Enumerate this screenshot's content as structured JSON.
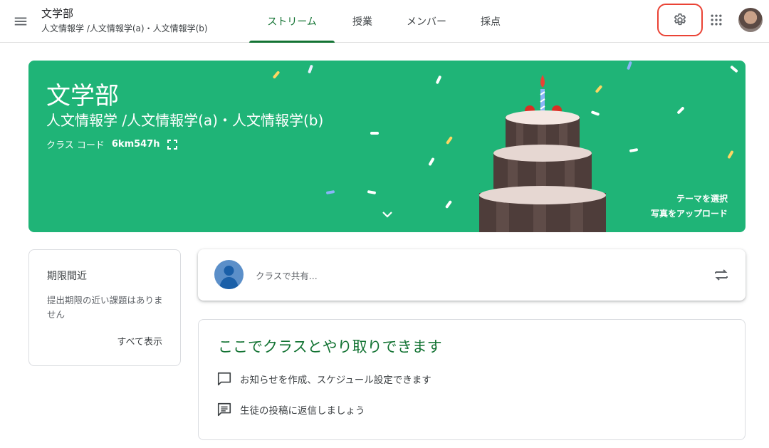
{
  "header": {
    "course_title": "文学部",
    "course_section": "人文情報学 /人文情報学(a)・人文情報学(b)",
    "tabs": [
      {
        "label": "ストリーム",
        "active": true
      },
      {
        "label": "授業",
        "active": false
      },
      {
        "label": "メンバー",
        "active": false
      },
      {
        "label": "採点",
        "active": false
      }
    ],
    "icons": [
      "menu-icon",
      "gear-icon",
      "apps-grid-icon",
      "user-avatar"
    ]
  },
  "banner": {
    "title": "文学部",
    "subtitle": "人文情報学 /人文情報学(a)・人文情報学(b)",
    "class_code_label": "クラス コード",
    "class_code_value": "6km547h",
    "select_theme": "テーマを選択",
    "upload_photo": "写真をアップロード",
    "background_color": "#1fb477"
  },
  "upcoming": {
    "title": "期限間近",
    "text": "提出期限の近い課題はありません",
    "view_all": "すべて表示"
  },
  "share": {
    "placeholder": "クラスで共有..."
  },
  "info": {
    "title": "ここでクラスとやり取りできます",
    "items": [
      "お知らせを作成、スケジュール設定できます",
      "生徒の投稿に返信しましょう"
    ]
  },
  "colors": {
    "accent": "#137333",
    "highlight_outline": "#ea4335"
  }
}
